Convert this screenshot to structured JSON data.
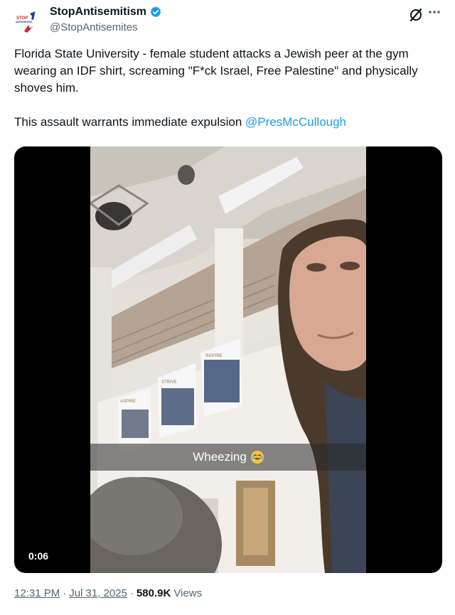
{
  "author": {
    "display_name": "StopAntisemitism",
    "handle": "@StopAntisemites",
    "avatar_text_top": "STOP",
    "avatar_text_bottom": "ANTISEMITISM",
    "verified": true
  },
  "tweet": {
    "paragraph_1": "Florida State University - female student attacks a Jewish peer at the gym wearing an IDF shirt, screaming \"F*ck Israel, Free Palestine\" and physically shoves him.",
    "paragraph_2_prefix": "This assault warrants immediate expulsion ",
    "mention": "@PresMcCullough"
  },
  "media": {
    "caption": "Wheezing",
    "caption_emoji": "crying-laughing-emoji",
    "duration": "0:06",
    "poster_label_1": "ASPIRE",
    "poster_label_2": "STRIVE",
    "poster_label_3": "INSPIRE"
  },
  "footer": {
    "time": "12:31 PM",
    "separator_1": "·",
    "date": "Jul 31, 2025",
    "separator_2": "·",
    "views_count": "580.9K",
    "views_label": "Views"
  },
  "colors": {
    "accent": "#1d9bf0",
    "text": "#0f1419",
    "muted": "#536471"
  }
}
